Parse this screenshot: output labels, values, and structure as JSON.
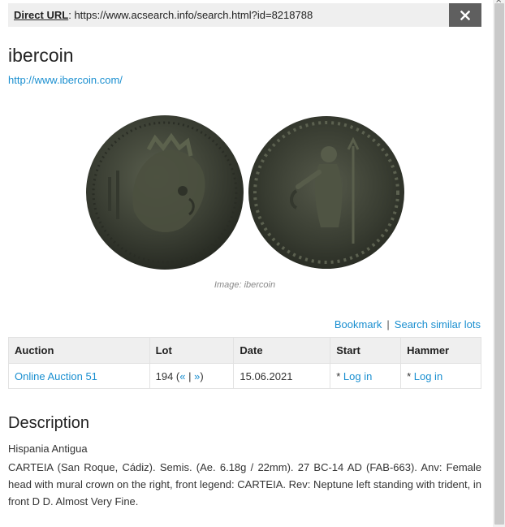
{
  "direct_url": {
    "label": "Direct URL",
    "separator": ":",
    "url": "https://www.acsearch.info/search.html?id=8218788",
    "close_icon": "close-icon"
  },
  "auction_house": {
    "name": "ibercoin",
    "website": "http://www.ibercoin.com/"
  },
  "image": {
    "caption": "Image: ibercoin",
    "colors": {
      "coin_dark": "#2c3026",
      "coin_mid": "#4a4f41",
      "coin_light": "#6d725f"
    }
  },
  "actions": {
    "bookmark": "Bookmark",
    "separator": "|",
    "search_similar": "Search similar lots"
  },
  "lots_table": {
    "headers": [
      "Auction",
      "Lot",
      "Date",
      "Start",
      "Hammer"
    ],
    "row": {
      "auction": "Online Auction 51",
      "lot_number": "194 (",
      "prev": "«",
      "lot_sep": " | ",
      "next": "»",
      "lot_close": ")",
      "date": "15.06.2021",
      "start_prefix": "* ",
      "start_link": "Log in",
      "hammer_prefix": "* ",
      "hammer_link": "Log in"
    }
  },
  "description": {
    "title": "Description",
    "heading": "Hispania Antigua",
    "text": "CARTEIA (San Roque, Cádiz). Semis. (Ae. 6.18g / 22mm). 27 BC-14 AD (FAB-663). Anv: Female head with mural crown on the right, front legend: CARTEIA. Rev: Neptune left standing with trident, in front D D. Almost Very Fine."
  },
  "theme": {
    "link_color": "#1a8fd0",
    "header_bg": "#efefef",
    "close_bg": "#5f5f5f"
  }
}
